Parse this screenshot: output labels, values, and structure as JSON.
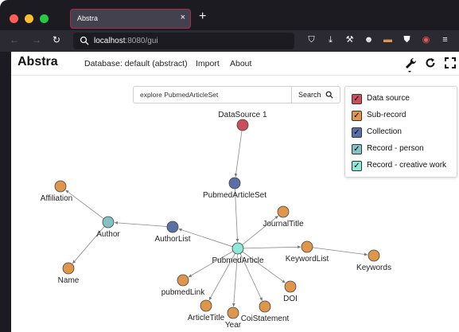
{
  "browser": {
    "tab_title": "Abstra",
    "tab_close": "×",
    "new_tab": "+",
    "url_host": "localhost",
    "url_rest": ":8080/gui"
  },
  "app": {
    "brand": "Abstra",
    "menu": [
      "Database: default (abstract)",
      "Import",
      "About"
    ]
  },
  "search": {
    "value": "explore PubmedArticleSet",
    "button_label": "Search"
  },
  "legend": {
    "items": [
      {
        "label": "Data source",
        "color": "#c8505a"
      },
      {
        "label": "Sub-record",
        "color": "#e0964a"
      },
      {
        "label": "Collection",
        "color": "#5a6fa3"
      },
      {
        "label": "Record - person",
        "color": "#84c1c4"
      },
      {
        "label": "Record - creative work",
        "color": "#8ee8d8"
      }
    ]
  },
  "colors": {
    "data_source": "#c8505a",
    "sub_record": "#e0964a",
    "collection": "#5a6fa3",
    "record_person": "#84c1c4",
    "record_creative": "#8ee8d8"
  },
  "graph": {
    "nodes": [
      {
        "id": "ds1",
        "label": "DataSource 1",
        "kind": "data_source"
      },
      {
        "id": "pas",
        "label": "PubmedArticleSet",
        "kind": "collection"
      },
      {
        "id": "pa",
        "label": "PubmedArticle",
        "kind": "record_creative"
      },
      {
        "id": "al",
        "label": "AuthorList",
        "kind": "collection"
      },
      {
        "id": "au",
        "label": "Author",
        "kind": "record_person"
      },
      {
        "id": "af",
        "label": "Affiliation",
        "kind": "sub_record"
      },
      {
        "id": "nm",
        "label": "Name",
        "kind": "sub_record"
      },
      {
        "id": "jt",
        "label": "JournalTitle",
        "kind": "sub_record"
      },
      {
        "id": "kl",
        "label": "KeywordList",
        "kind": "sub_record"
      },
      {
        "id": "kw",
        "label": "Keywords",
        "kind": "sub_record"
      },
      {
        "id": "doi",
        "label": "DOI",
        "kind": "sub_record"
      },
      {
        "id": "coi",
        "label": "CoiStatement",
        "kind": "sub_record"
      },
      {
        "id": "yr",
        "label": "Year",
        "kind": "sub_record"
      },
      {
        "id": "at",
        "label": "ArticleTitle",
        "kind": "sub_record"
      },
      {
        "id": "pl",
        "label": "pubmedLink",
        "kind": "sub_record"
      }
    ],
    "edges": [
      [
        "ds1",
        "pas"
      ],
      [
        "pas",
        "pa"
      ],
      [
        "pa",
        "al"
      ],
      [
        "al",
        "au"
      ],
      [
        "au",
        "af"
      ],
      [
        "au",
        "nm"
      ],
      [
        "pa",
        "jt"
      ],
      [
        "pa",
        "kl"
      ],
      [
        "kl",
        "kw"
      ],
      [
        "pa",
        "doi"
      ],
      [
        "pa",
        "coi"
      ],
      [
        "pa",
        "yr"
      ],
      [
        "pa",
        "at"
      ],
      [
        "pa",
        "pl"
      ]
    ]
  }
}
